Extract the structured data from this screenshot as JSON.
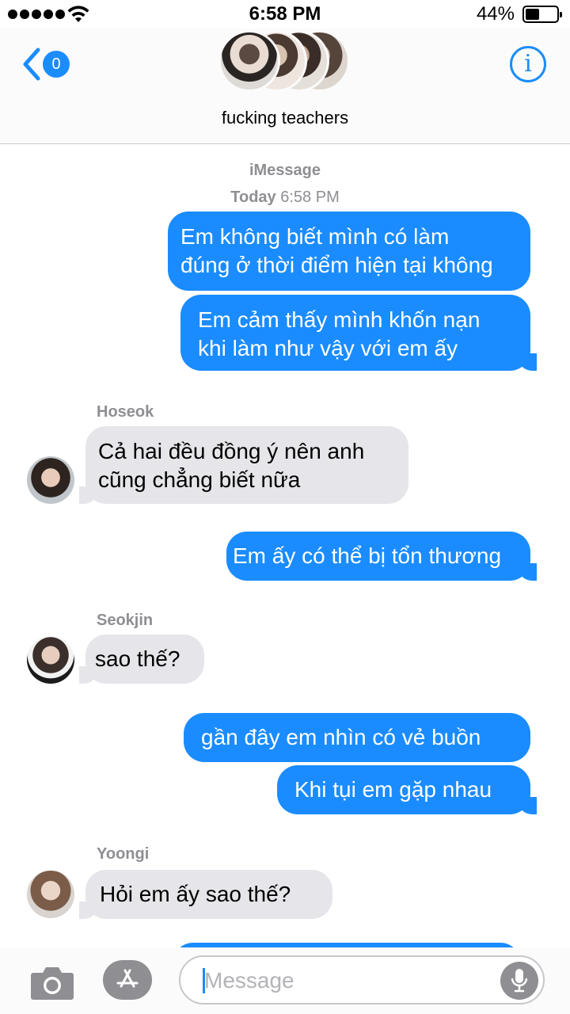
{
  "status_bar": {
    "time": "6:58 PM",
    "battery_percent": "44%",
    "battery_level": 0.44,
    "signal_bars": 5
  },
  "header": {
    "back_badge": "0",
    "group_name": "fucking teachers",
    "info_icon": "i"
  },
  "conversation": {
    "service": "iMessage",
    "timestamp_day": "Today",
    "timestamp_time": "6:58 PM",
    "messages": [
      {
        "direction": "outgoing",
        "text_line1": "Em không biết mình có làm",
        "text_line2": "đúng ở thời điểm hiện tại không"
      },
      {
        "direction": "outgoing",
        "text_line1": "Em cảm thấy mình khốn nạn",
        "text_line2": "khi làm như vậy với em ấy"
      },
      {
        "direction": "incoming",
        "sender": "Hoseok",
        "text_line1": "Cả hai đều đồng ý nên anh",
        "text_line2": "cũng chẳng biết nữa"
      },
      {
        "direction": "outgoing",
        "text": "Em ấy có thể bị tổn thương"
      },
      {
        "direction": "incoming",
        "sender": "Seokjin",
        "text": "sao thế?"
      },
      {
        "direction": "outgoing",
        "text": "gần đây em nhìn có vẻ buồn"
      },
      {
        "direction": "outgoing",
        "text": "Khi tụi em gặp nhau"
      },
      {
        "direction": "incoming",
        "sender": "Yoongi",
        "text": "Hỏi em ấy sao thế?"
      }
    ]
  },
  "input_bar": {
    "placeholder": "Message",
    "camera_icon": "camera-icon",
    "apps_icon": "app-store-icon",
    "mic_icon": "microphone-icon"
  },
  "colors": {
    "accent": "#1a8cff",
    "outgoing_bubble": "#1a8cff",
    "incoming_bubble": "#e5e5ea",
    "secondary_text": "#8e8e93"
  }
}
